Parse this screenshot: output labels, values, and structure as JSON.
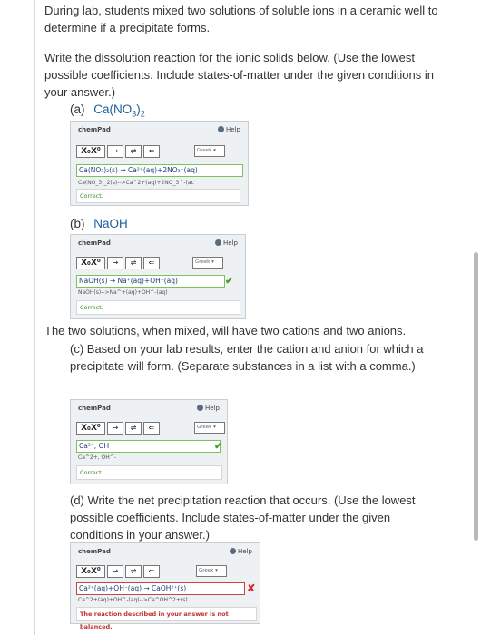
{
  "intro": {
    "line1": "During lab, students mixed two solutions of soluble ions in a ceramic well to",
    "line2": "determine if a precipitate forms.",
    "instruction1": "Write the dissolution reaction for the ionic solids below. (Use the lowest",
    "instruction2": "possible coefficients. Include states-of-matter under the given conditions in",
    "instruction3": "your answer.)"
  },
  "part_a": {
    "label": "(a)",
    "formula_main": "Ca(NO",
    "formula_sub1": "3",
    "formula_close": ")",
    "formula_sub2": "2",
    "chempad_title": "chemPad",
    "help_label": "Help",
    "greek_label": "Greek ▾",
    "answer": "Ca(NO₃)₂(s) → Ca²⁺(aq)+2NO₃⁻(aq)",
    "raw": "Ca(NO_3)_2(s)-->Ca^2+(aq)+2NO_3^-(ac",
    "feedback": "Correct."
  },
  "part_b": {
    "label": "(b)",
    "formula": "NaOH",
    "chempad_title": "chemPad",
    "help_label": "Help",
    "greek_label": "Greek ▾",
    "answer": "NaOH(s) → Na⁺(aq)+OH⁻(aq)",
    "raw": "NaOH(s)-->Na^+(aq)+OH^-(aq)",
    "feedback": "Correct."
  },
  "mixed_text": "The two solutions, when mixed, will have two cations and two anions.",
  "part_c": {
    "text1": "(c) Based on your lab results, enter the cation and anion for which a",
    "text2": "precipitate will form. (Separate substances in a list with a comma.)",
    "chempad_title": "chemPad",
    "help_label": "Help",
    "greek_label": "Greek ▾",
    "answer": "Ca²⁺, OH⁻",
    "raw": "Ca^2+, OH^-",
    "feedback": "Correct."
  },
  "part_d": {
    "text1": "(d) Write the net precipitation reaction that occurs. (Use the lowest",
    "text2": "possible coefficients. Include states-of-matter under the given",
    "text3": "conditions in your answer.)",
    "chempad_title": "chemPad",
    "help_label": "Help",
    "greek_label": "Greek ▾",
    "answer": "Ca²⁺(aq)+OH⁻(aq) → CaOH²⁺(s)",
    "raw": "Ca^2+(aq)+OH^-(aq)-->Ca^OH^2+(s)",
    "feedback": "The reaction described in your answer is not balanced."
  },
  "toolbar": {
    "subsup": "X₀X⁰",
    "arrow": "→",
    "equilibrium": "⇌",
    "backspace": "⇐"
  },
  "colors": {
    "formula": "#1c5e9a",
    "correct": "#3c8a2a",
    "incorrect": "#c03030"
  }
}
